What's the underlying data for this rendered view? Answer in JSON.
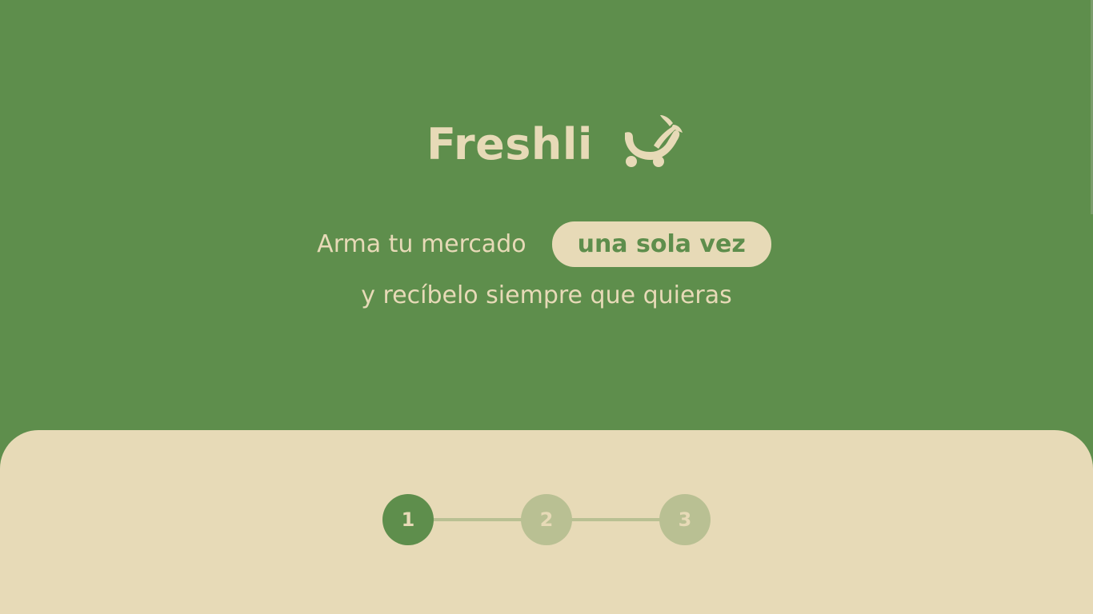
{
  "brand": {
    "name": "Freshli",
    "icon": "cart-icon"
  },
  "hero": {
    "tagline_prefix": "Arma tu mercado",
    "tagline_highlight": "una sola vez",
    "tagline_suffix": "y recíbelo siempre que quieras"
  },
  "stepper": {
    "steps": [
      {
        "label": "1",
        "state": "active"
      },
      {
        "label": "2",
        "state": "inactive"
      },
      {
        "label": "3",
        "state": "inactive"
      }
    ]
  },
  "colors": {
    "primary_green": "#5e8e4c",
    "cream": "#e7dab7",
    "muted_green": "#b9c093"
  }
}
